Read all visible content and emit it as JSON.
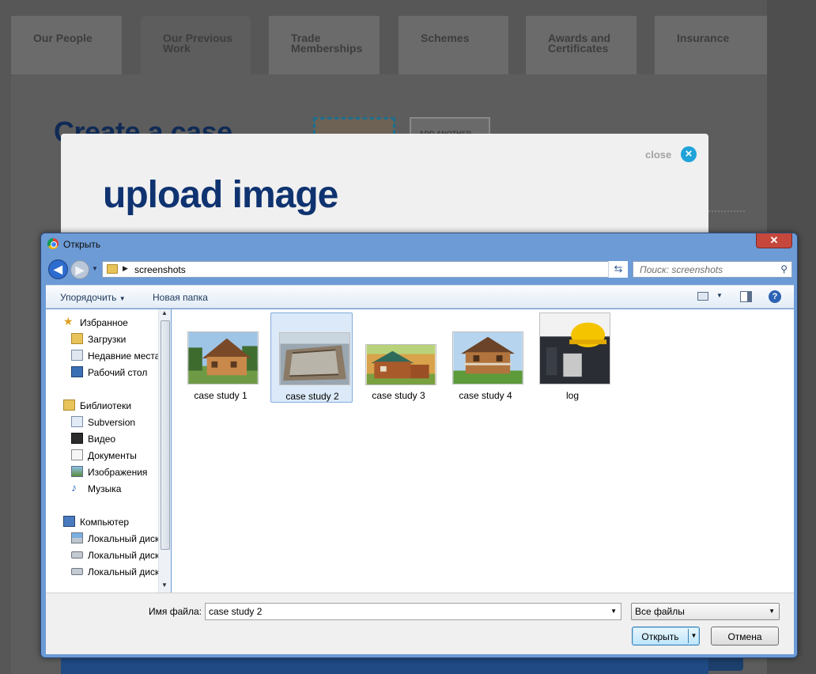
{
  "site": {
    "tabs": [
      {
        "line1": "Our People",
        "line2": ""
      },
      {
        "line1": "Our Previous",
        "line2": "Work"
      },
      {
        "line1": "Trade",
        "line2": "Memberships"
      },
      {
        "line1": "Schemes",
        "line2": ""
      },
      {
        "line1": "Awards and",
        "line2": "Certificates"
      },
      {
        "line1": "Insurance",
        "line2": ""
      }
    ],
    "heading": "Create a case",
    "add_another": "ADD ANOTHER"
  },
  "modal": {
    "close_label": "close",
    "title": "upload image"
  },
  "dialog": {
    "title": "Открыть",
    "address_folder": "screenshots",
    "search_placeholder": "Поиск: screenshots",
    "toolbar": {
      "organize": "Упорядочить",
      "new_folder": "Новая папка"
    },
    "nav": [
      {
        "label": "Избранное",
        "icon": "star-icon"
      },
      {
        "label": "Загрузки",
        "icon": "downloads-icon"
      },
      {
        "label": "Недавние места",
        "icon": "recent-places-icon"
      },
      {
        "label": "Рабочий стол",
        "icon": "desktop-icon"
      },
      {
        "label": "Библиотеки",
        "icon": "libraries-icon"
      },
      {
        "label": "Subversion",
        "icon": "library-folder-icon"
      },
      {
        "label": "Видео",
        "icon": "video-icon"
      },
      {
        "label": "Документы",
        "icon": "documents-icon"
      },
      {
        "label": "Изображения",
        "icon": "pictures-icon"
      },
      {
        "label": "Музыка",
        "icon": "music-icon"
      },
      {
        "label": "Компьютер",
        "icon": "computer-icon"
      },
      {
        "label": "Локальный диск",
        "icon": "system-disk-icon"
      },
      {
        "label": "Локальный диск",
        "icon": "disk-icon"
      },
      {
        "label": "Локальный диск",
        "icon": "disk-icon"
      }
    ],
    "files": [
      {
        "name": "case study 1",
        "selected": false
      },
      {
        "name": "case study 2",
        "selected": true
      },
      {
        "name": "case study 3",
        "selected": false
      },
      {
        "name": "case study 4",
        "selected": false
      },
      {
        "name": "log",
        "selected": false
      }
    ],
    "filename_label": "Имя файла:",
    "filename_value": "case study 2",
    "filter_value": "Все файлы",
    "open_button": "Открыть",
    "cancel_button": "Отмена"
  },
  "colors": {
    "modal_title": "#0f3370",
    "close_accent": "#1fa3d9",
    "dialog_frame": "#6d9bd6",
    "selection": "#dbe9f8"
  }
}
